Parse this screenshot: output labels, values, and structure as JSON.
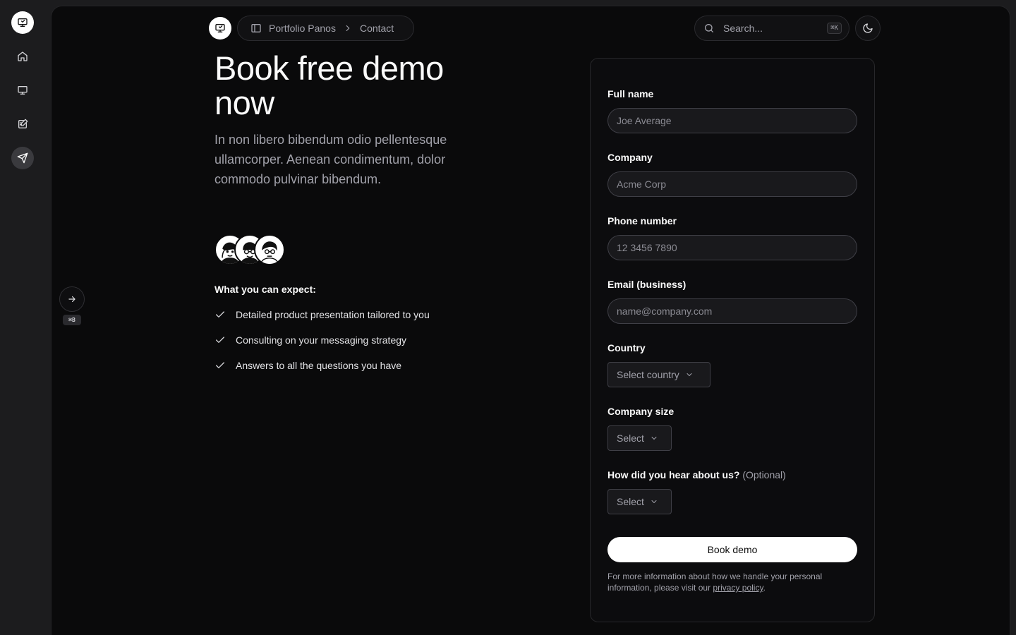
{
  "rail": {
    "items": [
      {
        "name": "presentation-logo-icon"
      },
      {
        "name": "home-icon"
      },
      {
        "name": "presentation-icon"
      },
      {
        "name": "edit-note-icon"
      },
      {
        "name": "send-icon"
      }
    ]
  },
  "topbar": {
    "breadcrumb": {
      "root": "Portfolio Panos",
      "current": "Contact"
    },
    "search_placeholder": "Search...",
    "search_shortcut": "⌘K"
  },
  "sidebar_toggle_shortcut": "⌘B",
  "hero": {
    "title": "Book free demo now",
    "subtitle": "In non libero bibendum odio pellentesque ullamcorper. Aenean condimentum, dolor commodo pulvinar bibendum.",
    "expect_title": "What you can expect:",
    "expect_items": [
      "Detailed product presentation tailored to you",
      "Consulting on your messaging strategy",
      "Answers to all the questions you have"
    ]
  },
  "form": {
    "full_name": {
      "label": "Full name",
      "placeholder": "Joe Average"
    },
    "company": {
      "label": "Company",
      "placeholder": "Acme Corp"
    },
    "phone": {
      "label": "Phone number",
      "placeholder": "12 3456 7890"
    },
    "email": {
      "label": "Email (business)",
      "placeholder": "name@company.com"
    },
    "country": {
      "label": "Country",
      "value": "Select country"
    },
    "company_size": {
      "label": "Company size",
      "value": "Select"
    },
    "hear_about": {
      "label": "How did you hear about us?",
      "optional": "(Optional)",
      "value": "Select"
    },
    "submit_label": "Book demo",
    "fine_print": "For more information about how we handle your personal information, please visit our",
    "privacy_link": "privacy policy",
    "fine_print_end": "."
  },
  "colors": {
    "background": "#0a0a0b",
    "rail": "#1c1c1e",
    "accent": "#ffffff"
  }
}
